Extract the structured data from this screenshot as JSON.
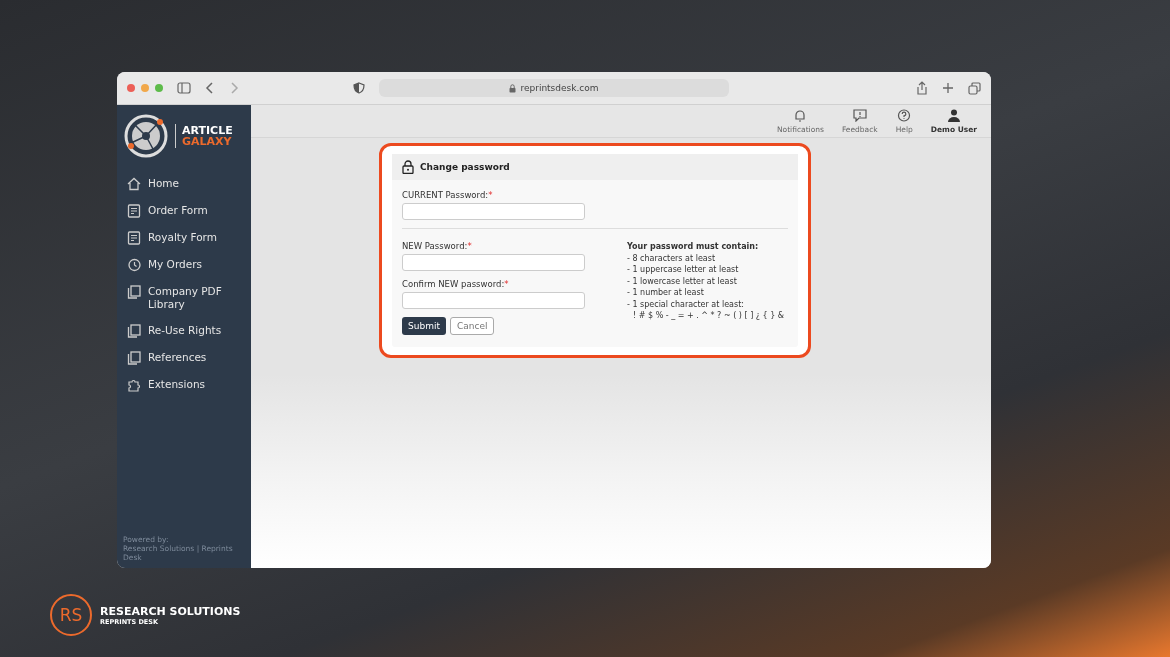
{
  "browser": {
    "url": "reprintsdesk.com"
  },
  "sidebar": {
    "logo": {
      "line_1": "ARTICLE",
      "line_2": "GALAXY"
    },
    "items": [
      {
        "label": "Home"
      },
      {
        "label": "Order Form"
      },
      {
        "label": "Royalty Form"
      },
      {
        "label": "My Orders"
      },
      {
        "label": "Company PDF Library"
      },
      {
        "label": "Re-Use Rights"
      },
      {
        "label": "References"
      },
      {
        "label": "Extensions"
      }
    ],
    "footer": [
      "Powered by:",
      "Research Solutions | Reprints Desk"
    ]
  },
  "topbar": [
    {
      "label": "Notifications"
    },
    {
      "label": "Feedback"
    },
    {
      "label": "Help"
    },
    {
      "label": "Demo User"
    }
  ],
  "card": {
    "title": "Change password",
    "current": {
      "label": "CURRENT Password:",
      "required_mark": "*"
    },
    "fields": [
      {
        "label": "NEW Password:",
        "required_mark": "*"
      },
      {
        "label": "Confirm NEW password:",
        "required_mark": "*"
      }
    ],
    "buttons": {
      "submit": "Submit",
      "cancel": "Cancel"
    },
    "rules": {
      "title": "Your password must contain:",
      "items": [
        "- 8 characters at least",
        "- 1 uppercase letter at least",
        "- 1 lowercase letter at least",
        "- 1 number at least",
        "- 1 special character at least:",
        "! # $ % - _ = + . ^ * ? ~ ( ) [ ] ¿ { } &"
      ]
    }
  },
  "brand": {
    "mark": "RS",
    "name": "RESEARCH SOLUTIONS",
    "sub": "REPRINTS DESK"
  }
}
